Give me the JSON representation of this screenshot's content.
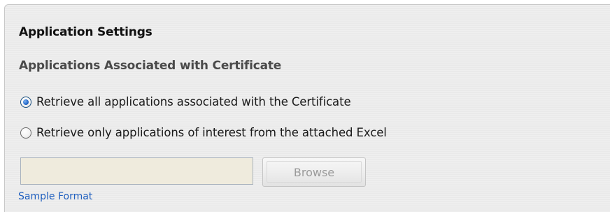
{
  "panel": {
    "title": "Application Settings",
    "section_title": "Applications Associated with Certificate"
  },
  "options": [
    {
      "label": "Retrieve all applications associated with the Certificate",
      "selected": true
    },
    {
      "label": "Retrieve only applications of interest from the attached Excel",
      "selected": false
    }
  ],
  "file_input": {
    "value": "",
    "placeholder": ""
  },
  "browse_button": {
    "label": "Browse",
    "enabled": false
  },
  "sample_link": {
    "label": "Sample Format"
  },
  "colors": {
    "input_background": "#efebdd",
    "link": "#1f5fbf",
    "radio_selected": "#2a6fcf",
    "panel_background": "#ececec"
  }
}
